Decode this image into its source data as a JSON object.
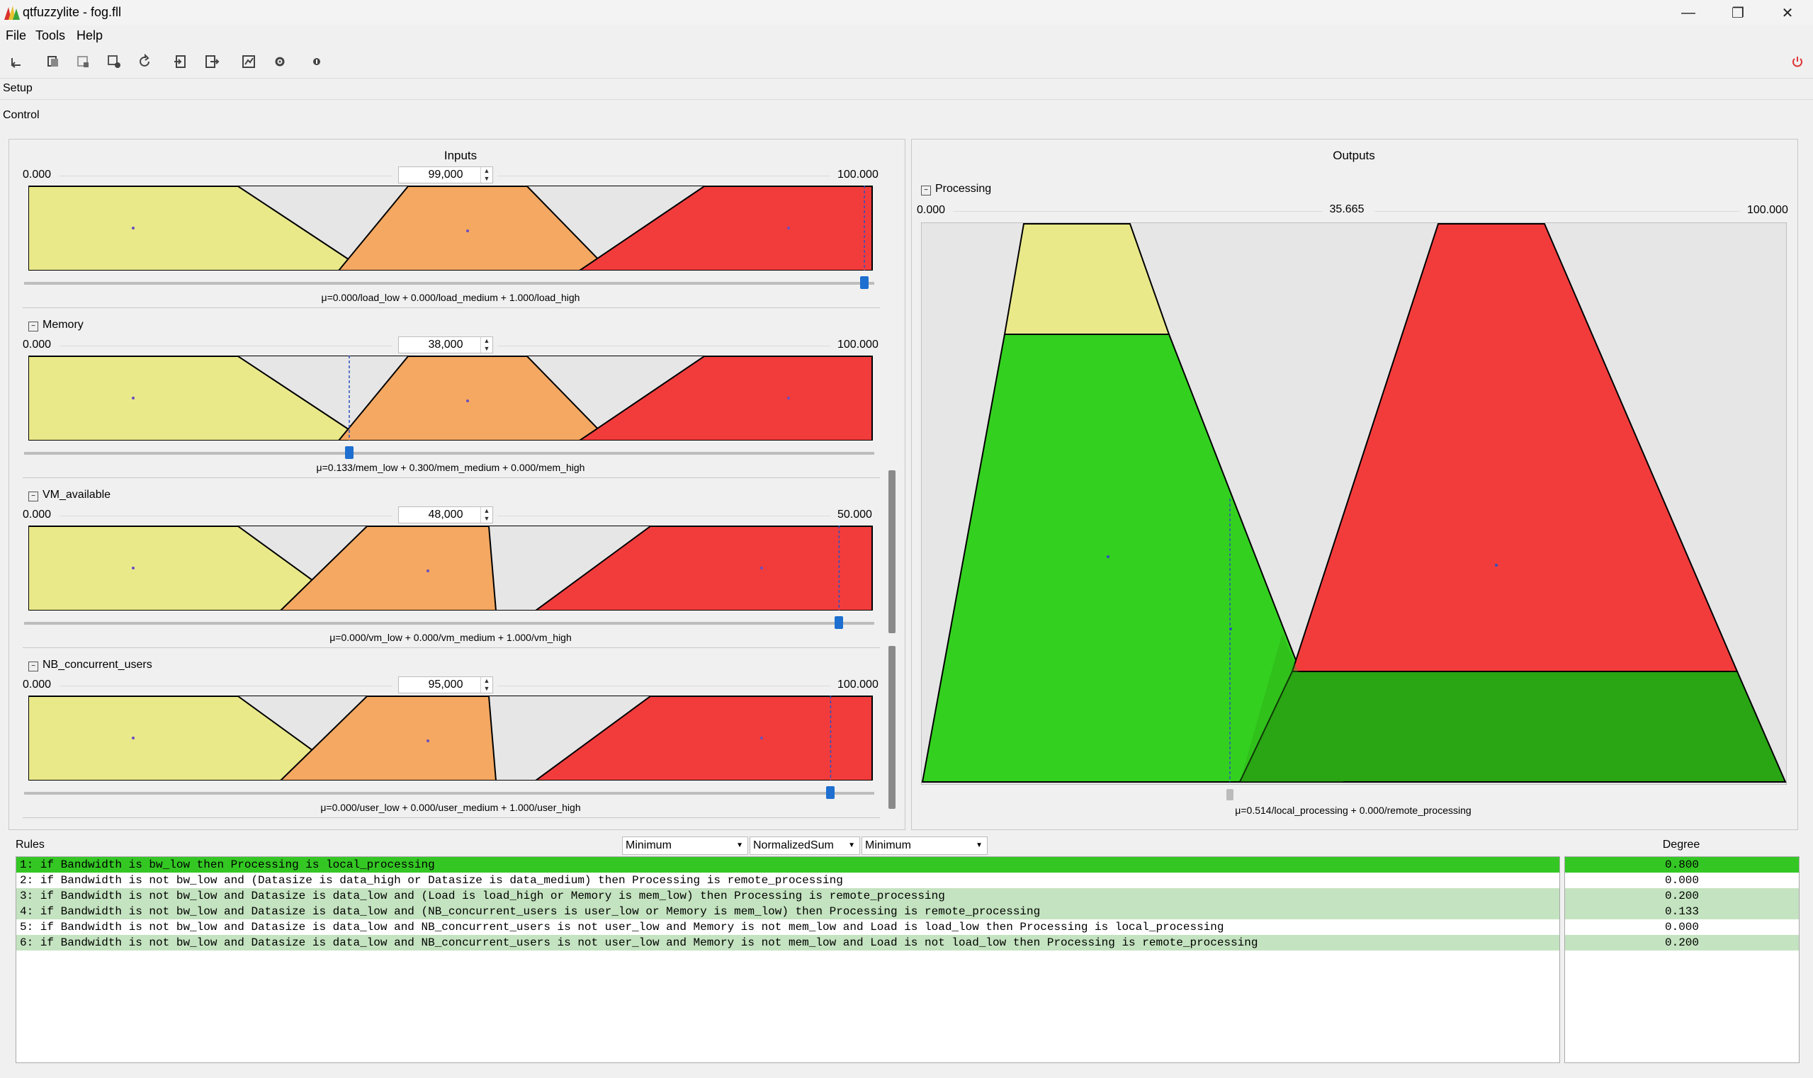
{
  "window": {
    "title": "qtfuzzylite - fog.fll",
    "min_glyph": "—",
    "max_glyph": "❐",
    "close_glyph": "✕"
  },
  "menu": {
    "items": [
      "File",
      "Tools",
      "Help"
    ]
  },
  "sections": {
    "setup": "Setup",
    "control": "Control"
  },
  "inputs_panel": {
    "title": "Inputs",
    "variables": [
      {
        "name": "",
        "min": "0.000",
        "max": "100.000",
        "value": "99,000",
        "value_num": 99,
        "range": 100,
        "mu": "μ=0.000/load_low + 0.000/load_medium + 1.000/load_high"
      },
      {
        "name": "Memory",
        "min": "0.000",
        "max": "100.000",
        "value": "38,000",
        "value_num": 38,
        "range": 100,
        "mu": "μ=0.133/mem_low + 0.300/mem_medium + 0.000/mem_high"
      },
      {
        "name": "VM_available",
        "min": "0.000",
        "max": "50.000",
        "value": "48,000",
        "value_num": 48,
        "range": 50,
        "mu": "μ=0.000/vm_low + 0.000/vm_medium + 1.000/vm_high"
      },
      {
        "name": "NB_concurrent_users",
        "min": "0.000",
        "max": "100.000",
        "value": "95,000",
        "value_num": 95,
        "range": 100,
        "mu": "μ=0.000/user_low + 0.000/user_medium + 1.000/user_high"
      }
    ]
  },
  "outputs_panel": {
    "title": "Outputs",
    "variable": {
      "name": "Processing",
      "min": "0.000",
      "max": "100.000",
      "value": "35.665",
      "value_num": 35.665,
      "mu": "μ=0.514/local_processing + 0.000/remote_processing"
    }
  },
  "rules_panel": {
    "label": "Rules",
    "conjunction": "Minimum",
    "aggregation": "NormalizedSum",
    "activation": "Minimum",
    "degree_label": "Degree",
    "rules": [
      {
        "text": "1: if Bandwidth is bw_low then Processing is local_processing",
        "degree": "0.800",
        "level": 0.8
      },
      {
        "text": "2: if Bandwidth is not bw_low and (Datasize is data_high or Datasize is data_medium) then Processing is remote_processing",
        "degree": "0.000",
        "level": 0
      },
      {
        "text": "3: if Bandwidth is not bw_low and Datasize is data_low and (Load is load_high or Memory is mem_low) then Processing is remote_processing",
        "degree": "0.200",
        "level": 0.2
      },
      {
        "text": "4: if Bandwidth is not bw_low and Datasize is data_low and (NB_concurrent_users is user_low or Memory is mem_low) then Processing is remote_processing",
        "degree": "0.133",
        "level": 0.133
      },
      {
        "text": "5: if Bandwidth is not bw_low and Datasize is data_low and NB_concurrent_users is not user_low and Memory is not mem_low and Load is load_low then Processing is local_processing",
        "degree": "0.000",
        "level": 0
      },
      {
        "text": "6: if Bandwidth is not bw_low and Datasize is data_low and NB_concurrent_users is not user_low and Memory is not mem_low and Load is not load_low then Processing is remote_processing",
        "degree": "0.200",
        "level": 0.2
      }
    ]
  },
  "colors": {
    "low": "#e9e98a",
    "medium": "#f4a862",
    "high": "#f23c3c",
    "local": "#34d020",
    "local_dark": "#2aa514",
    "accent": "#1e6fd0",
    "rule_full": "#34c724",
    "rule_light": "#c4e3c0"
  }
}
